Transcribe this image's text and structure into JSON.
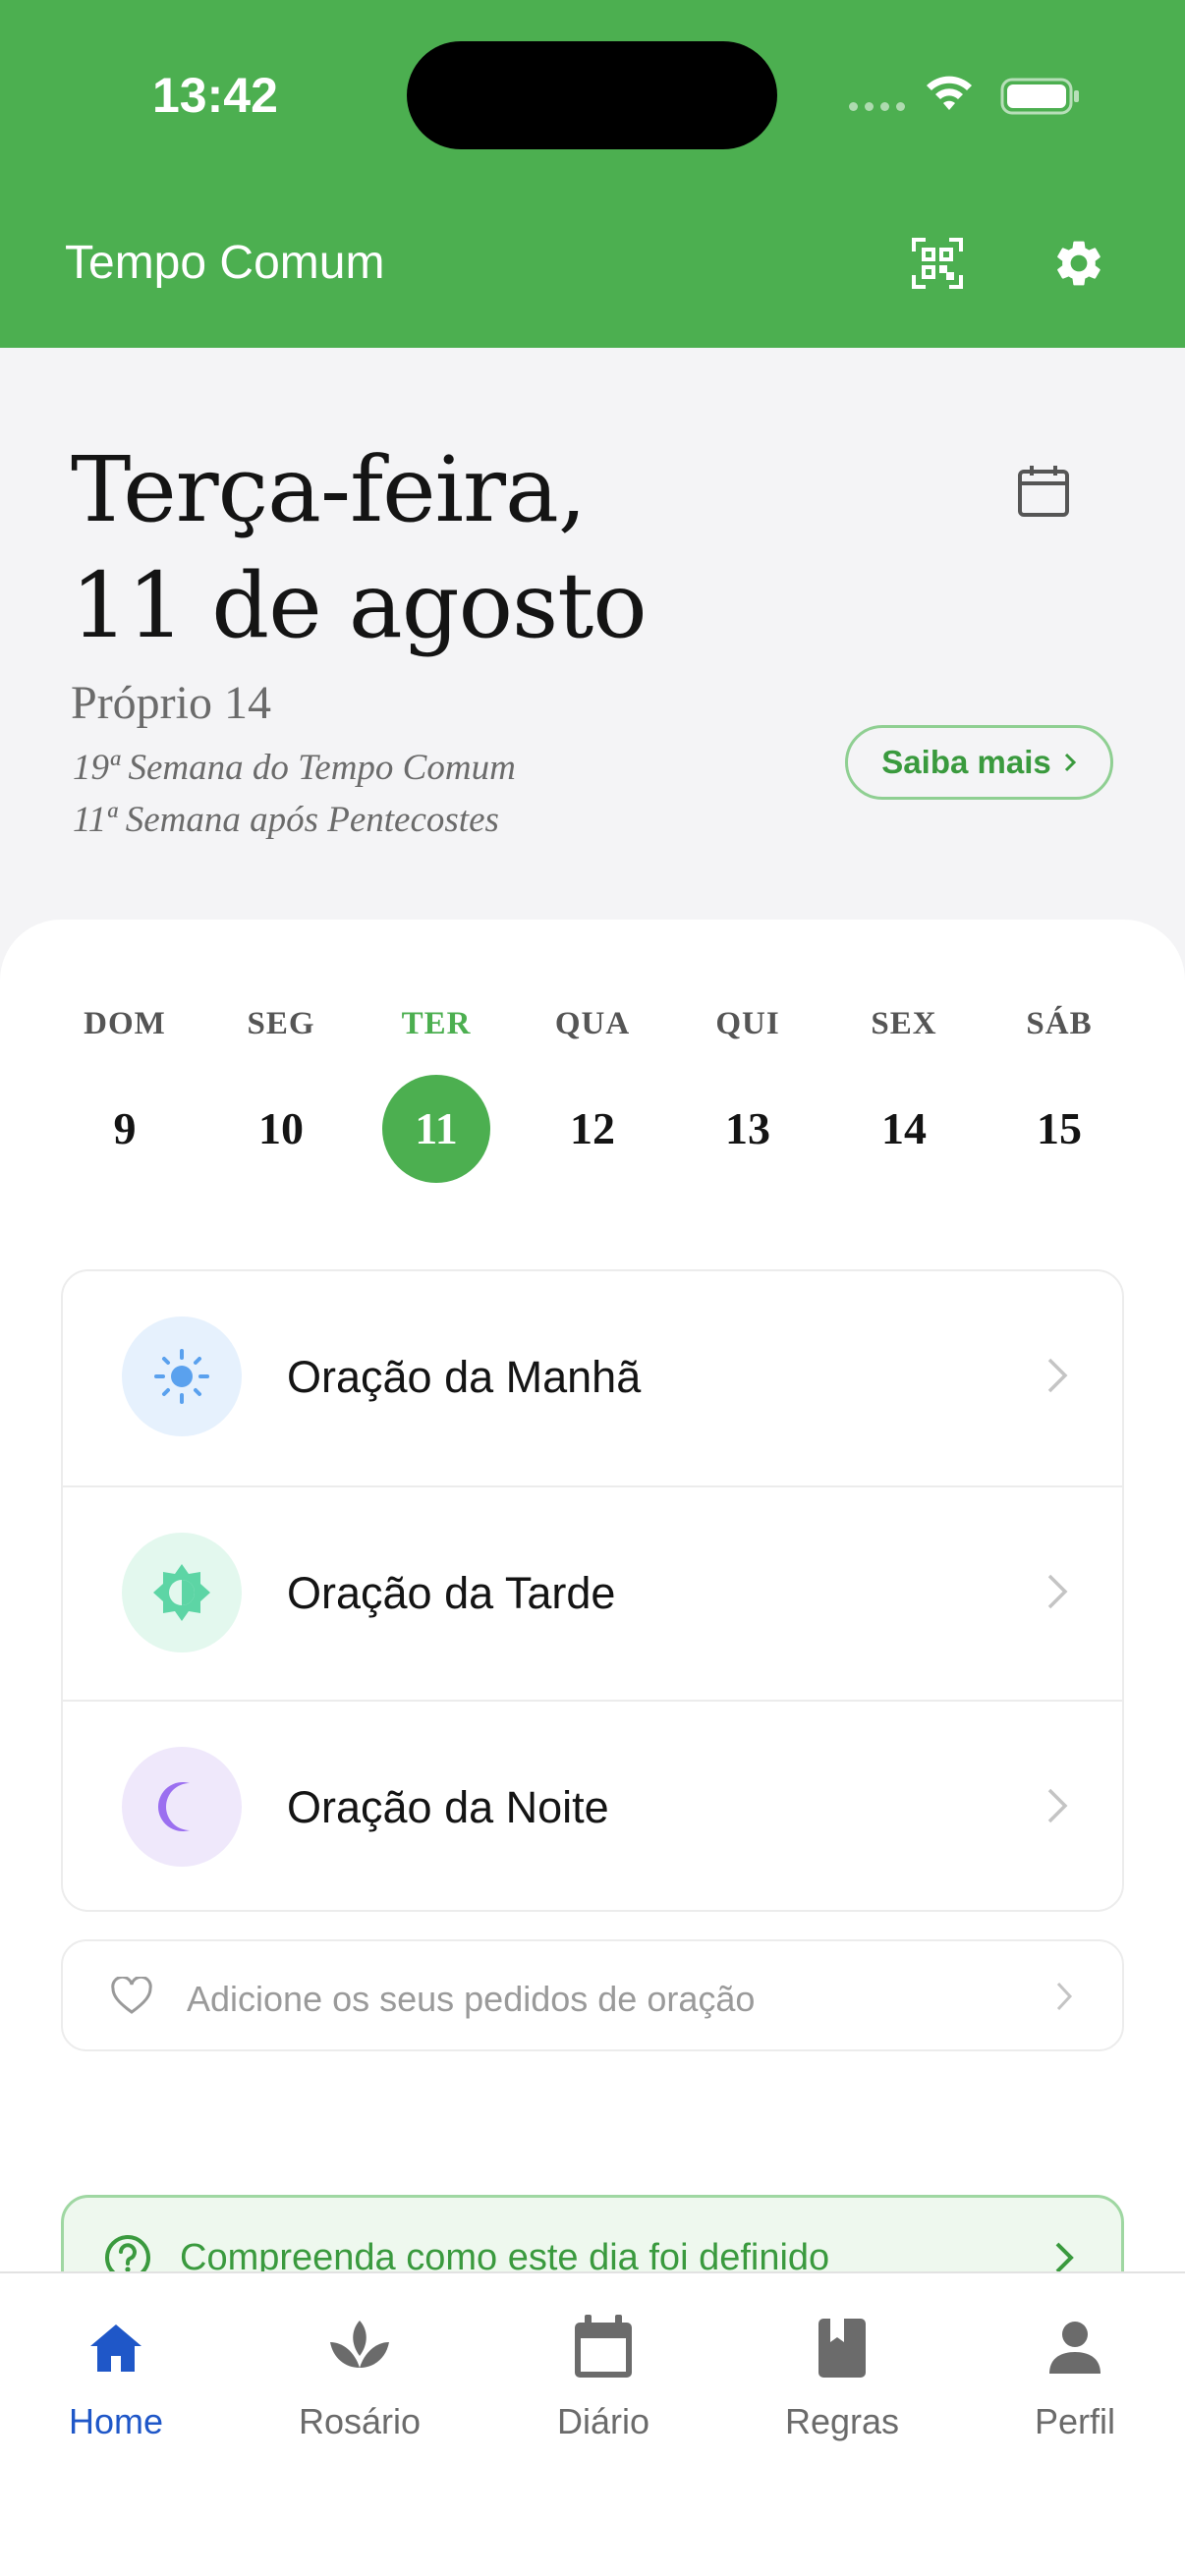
{
  "status_bar": {
    "time": "13:42"
  },
  "header": {
    "title": "Tempo Comum",
    "qr_icon": "qr-code-icon",
    "settings_icon": "gear-icon",
    "background": "#4caf50"
  },
  "date_section": {
    "weekday_line": "Terça-feira,",
    "date_line": "11 de agosto",
    "proper": "Próprio 14",
    "week_ordinary": "19ª Semana do Tempo Comum",
    "week_pentecost": "11ª Semana após Pentecostes",
    "more_button": "Saiba mais"
  },
  "week_strip": {
    "days": [
      {
        "weekday": "DOM",
        "day": "9"
      },
      {
        "weekday": "SEG",
        "day": "10"
      },
      {
        "weekday": "TER",
        "day": "11",
        "selected": true
      },
      {
        "weekday": "QUA",
        "day": "12"
      },
      {
        "weekday": "QUI",
        "day": "13"
      },
      {
        "weekday": "SEX",
        "day": "14"
      },
      {
        "weekday": "SÁB",
        "day": "15"
      }
    ]
  },
  "prayers": [
    {
      "label": "Oração da Manhã",
      "icon": "sun-icon",
      "icon_bg": "#e6f1fd",
      "icon_color": "#5aa1ee"
    },
    {
      "label": "Oração da Tarde",
      "icon": "sun-half-icon",
      "icon_bg": "#e3f8ee",
      "icon_color": "#5dd5a5"
    },
    {
      "label": "Oração da Noite",
      "icon": "moon-icon",
      "icon_bg": "#efe8fb",
      "icon_color": "#9b6ff0"
    }
  ],
  "requests": {
    "label": "Adicione os seus pedidos de oração"
  },
  "understand": {
    "label": "Compreenda como este dia foi definido"
  },
  "tabbar": {
    "tabs": [
      {
        "label": "Home",
        "icon": "home-icon",
        "active": true
      },
      {
        "label": "Rosário",
        "icon": "lotus-icon"
      },
      {
        "label": "Diário",
        "icon": "calendar-icon"
      },
      {
        "label": "Regras",
        "icon": "book-icon"
      },
      {
        "label": "Perfil",
        "icon": "person-icon"
      }
    ],
    "active_color": "#1f57c8"
  }
}
